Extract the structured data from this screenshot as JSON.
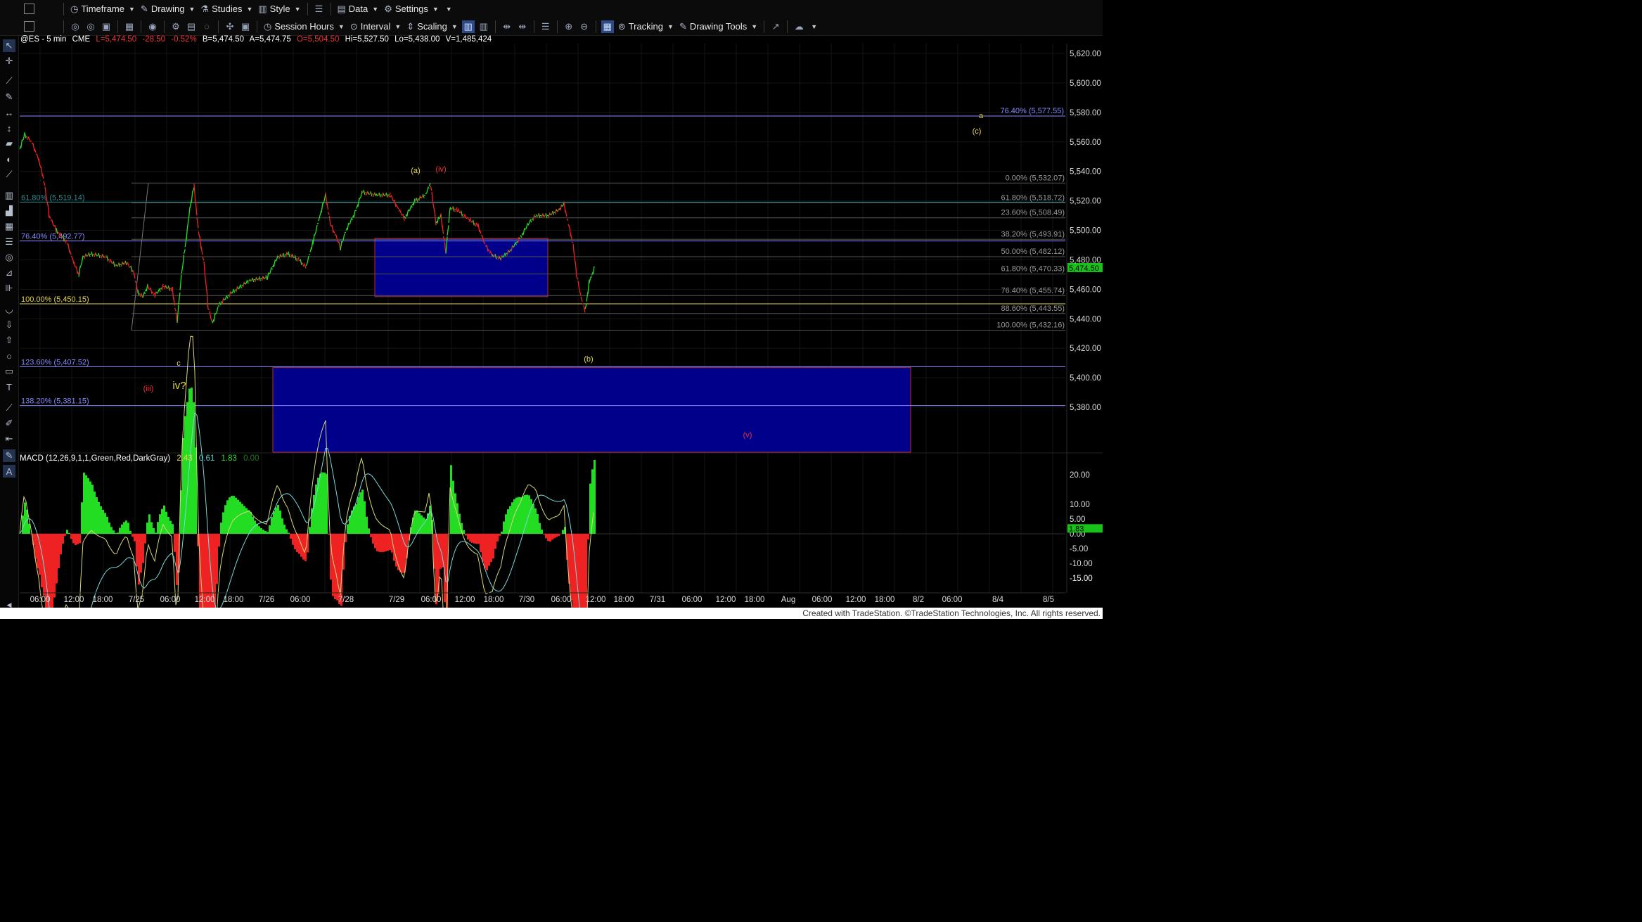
{
  "toolbar1": {
    "timeframe": "Timeframe",
    "drawing": "Drawing",
    "studies": "Studies",
    "style": "Style",
    "data": "Data",
    "settings": "Settings"
  },
  "toolbar2": {
    "session_hours": "Session Hours",
    "interval": "Interval",
    "scaling": "Scaling",
    "tracking": "Tracking",
    "drawing_tools": "Drawing Tools"
  },
  "symbol_info": {
    "symbol": "@ES - 5 min",
    "exchange": "CME",
    "last": "L=5,474.50",
    "change": "-28.50",
    "pct": "-0.52%",
    "bid": "B=5,474.50",
    "ask": "A=5,474.75",
    "open": "O=5,504.50",
    "high": "Hi=5,527.50",
    "low": "Lo=5,438.00",
    "volume": "V=1,485,424"
  },
  "macd_info": {
    "label": "MACD (12,26,9,1,1,Green,Red,DarkGray)",
    "v1": "2.43",
    "v2": "0.61",
    "v3": "1.83",
    "v4": "0.00"
  },
  "colors": {
    "up": "#22dd22",
    "down": "#ee2222",
    "yellow": "#e6d84a",
    "fib_blue": "#8888ff",
    "fib_teal": "#2a8c8c",
    "box_fill": "#00008b",
    "box_border": "#b03030",
    "price_tag": "#19c219"
  },
  "price_axis": {
    "ticks": [
      "5,620.00",
      "5,600.00",
      "5,580.00",
      "5,560.00",
      "5,540.00",
      "5,520.00",
      "5,500.00",
      "5,480.00",
      "5,460.00",
      "5,440.00",
      "5,420.00",
      "5,400.00",
      "5,380.00"
    ],
    "current": "5,474.50"
  },
  "macd_axis": {
    "ticks": [
      "20.00",
      "15.00",
      "10.00",
      "5.00",
      "0.00",
      "-5.00",
      "-10.00",
      "-15.00"
    ],
    "current": "1.83"
  },
  "time_axis": [
    "06:00",
    "12:00",
    "18:00",
    "7/25",
    "06:00",
    "12:00",
    "18:00",
    "7/26",
    "06:00",
    "7/28",
    "7/29",
    "06:00",
    "12:00",
    "18:00",
    "7/30",
    "06:00",
    "12:00",
    "18:00",
    "7/31",
    "06:00",
    "12:00",
    "18:00",
    "Aug",
    "06:00",
    "12:00",
    "18:00",
    "8/2",
    "06:00",
    "8/4",
    "8/5"
  ],
  "fib_left": [
    {
      "text": "61.80% (5,519.14)",
      "price": 5519.14,
      "color": "#2a8c8c"
    },
    {
      "text": "76.40% (5,492.77)",
      "price": 5492.77,
      "color": "#8888ff"
    },
    {
      "text": "100.00% (5,450.15)",
      "price": 5450.15,
      "color": "#e6d84a"
    },
    {
      "text": "123.60% (5,407.52)",
      "price": 5407.52,
      "color": "#8888ff"
    },
    {
      "text": "138.20% (5,381.15)",
      "price": 5381.15,
      "color": "#8888ff"
    }
  ],
  "fib_right": [
    {
      "text": "0.00% (5,532.07)",
      "price": 5532.07
    },
    {
      "text": "61.80% (5,518.72)",
      "price": 5518.72
    },
    {
      "text": "23.60% (5,508.49)",
      "price": 5508.49
    },
    {
      "text": "38.20% (5,493.91)",
      "price": 5493.91
    },
    {
      "text": "50.00% (5,482.12)",
      "price": 5482.12
    },
    {
      "text": "61.80% (5,470.33)",
      "price": 5470.33
    },
    {
      "text": "76.40% (5,455.74)",
      "price": 5455.74
    },
    {
      "text": "88.60% (5,443.55)",
      "price": 5443.55
    },
    {
      "text": "100.00% (5,432.16)",
      "price": 5432.16
    }
  ],
  "fib_top": {
    "text": "76.40% (5,577.55)",
    "price": 5577.55
  },
  "wave_labels": [
    {
      "text": "a",
      "color": "#e6d84a"
    },
    {
      "text": "(c)",
      "color": "#e6d84a"
    },
    {
      "text": "(a)",
      "color": "#e6d84a"
    },
    {
      "text": "(iv)",
      "color": "#ee3333"
    },
    {
      "text": "c",
      "color": "#e6d84a"
    },
    {
      "text": "(b)",
      "color": "#e6d84a"
    },
    {
      "text": "(iii)",
      "color": "#ee3333"
    },
    {
      "text": "iv?",
      "color": "#e6d84a"
    },
    {
      "text": "(v)",
      "color": "#ee3333"
    }
  ],
  "copyright": "Created with TradeStation. ©TradeStation Technologies, Inc. All rights reserved."
}
